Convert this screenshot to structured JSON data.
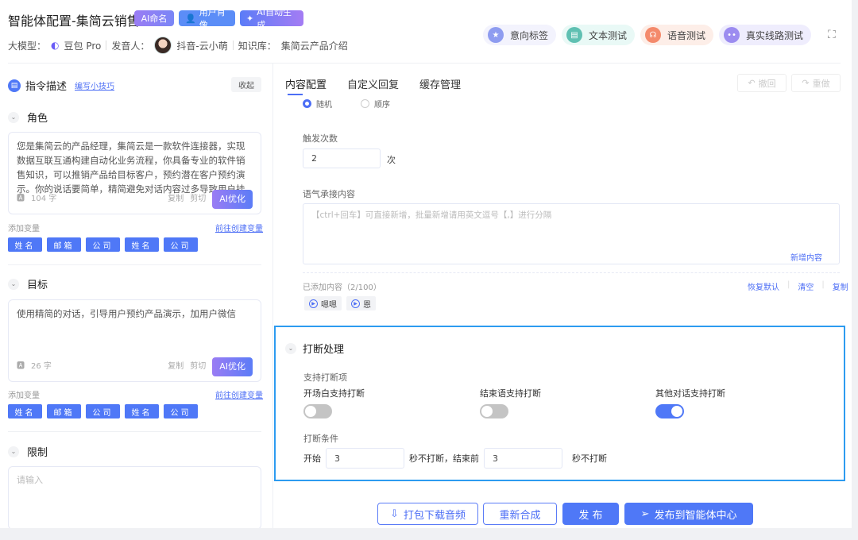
{
  "header": {
    "title": "智能体配置-集简云销售",
    "pills": [
      "AI命名",
      "用户肖像",
      "AI自动生成"
    ],
    "model_label": "大模型：",
    "model": "豆包 Pro",
    "speaker_label": "发音人：",
    "speaker": "抖音-云小萌",
    "kb_label": "知识库：",
    "kb": "集简云产品介绍",
    "tools": [
      "意向标签",
      "文本测试",
      "语音测试",
      "真实线路测试"
    ]
  },
  "left": {
    "title": "指令描述",
    "tips": "编写小技巧",
    "collapse": "收起",
    "sections": [
      {
        "name": "角色",
        "text": "您是集简云的产品经理，集简云是一款软件连接器，实现数据互联互通构建自动化业务流程，你具备专业的软件销售知识，可以推销产品给目标客户，预约潜在客户预约演示。你的说话要简单，精简避免对话内容过多导致用户挂断电话",
        "count": "104 字"
      },
      {
        "name": "目标",
        "text": "使用精简的对话，引导用户预约产品演示，加用户微信",
        "count": "26 字"
      },
      {
        "name": "限制",
        "placeholder": "请输入"
      }
    ],
    "copy": "复制",
    "cut": "剪切",
    "ai": "AI优化",
    "add_var": "添加变量",
    "create_var": "前往创建变量",
    "vars": [
      "姓名",
      "邮箱",
      "公司",
      "姓名",
      "公司"
    ]
  },
  "right": {
    "tabs": [
      "内容配置",
      "自定义回复",
      "缓存管理"
    ],
    "undo": "撤回",
    "redo": "重做",
    "radios": [
      "随机",
      "顺序"
    ],
    "trigger_label": "触发次数",
    "trigger_value": "2",
    "trigger_unit": "次",
    "tone_label": "语气承接内容",
    "tone_placeholder": "【ctrl+回车】可直接新增，批量新增请用英文逗号【,】进行分隔",
    "add_content": "新增内容",
    "added": "已添加内容（2/100）",
    "restore": "恢复默认",
    "clear": "清空",
    "copy": "复制",
    "chips": [
      "嗯嗯",
      "恩"
    ],
    "interrupt": {
      "title": "打断处理",
      "support_label": "支持打断项",
      "switches": [
        {
          "label": "开场白支持打断",
          "on": false
        },
        {
          "label": "结束语支持打断",
          "on": false
        },
        {
          "label": "其他对话支持打断",
          "on": true
        }
      ],
      "cond_label": "打断条件",
      "start": "开始",
      "start_val": "3",
      "mid": "秒不打断，结束前",
      "end_val": "3",
      "end": "秒不打断"
    },
    "buttons": [
      "打包下载音频",
      "重新合成",
      "发 布",
      "发布到智能体中心"
    ]
  }
}
